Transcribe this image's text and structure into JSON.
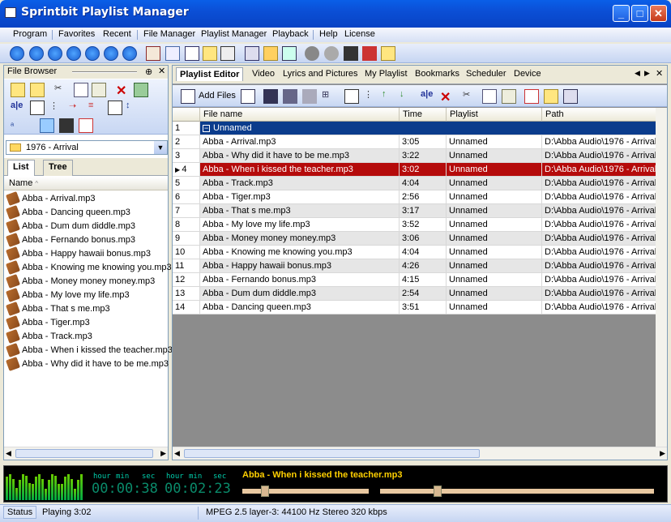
{
  "window": {
    "title": "Sprintbit Playlist Manager"
  },
  "menu": [
    "Program",
    "Favorites",
    "Recent",
    "File Manager",
    "Playlist Manager",
    "Playback",
    "Help",
    "License"
  ],
  "file_browser": {
    "title": "File Browser",
    "folder": "1976 - Arrival",
    "tabs": [
      "List",
      "Tree"
    ],
    "column": "Name",
    "files": [
      "Abba - Arrival.mp3",
      "Abba - Dancing queen.mp3",
      "Abba - Dum dum diddle.mp3",
      "Abba - Fernando bonus.mp3",
      "Abba - Happy hawaii bonus.mp3",
      "Abba - Knowing me knowing you.mp3",
      "Abba - Money money money.mp3",
      "Abba - My love my life.mp3",
      "Abba - That s me.mp3",
      "Abba - Tiger.mp3",
      "Abba - Track.mp3",
      "Abba - When i kissed the teacher.mp3",
      "Abba - Why did it have to be me.mp3"
    ]
  },
  "editor": {
    "tabs": [
      "Playlist Editor",
      "Video",
      "Lyrics and Pictures",
      "My Playlist",
      "Bookmarks",
      "Scheduler",
      "Device"
    ],
    "add_files_label": "Add Files",
    "columns": [
      "File name",
      "Time",
      "Playlist",
      "Path"
    ],
    "group_label": "Unnamed",
    "rows": [
      {
        "n": "2",
        "name": "Abba - Arrival.mp3",
        "time": "3:05",
        "playlist": "Unnamed",
        "path": "D:\\Abba Audio\\1976 - Arrival..."
      },
      {
        "n": "3",
        "name": "Abba - Why did it have to be me.mp3",
        "time": "3:22",
        "playlist": "Unnamed",
        "path": "D:\\Abba Audio\\1976 - Arrival..."
      },
      {
        "n": "4",
        "name": "Abba - When i kissed the teacher.mp3",
        "time": "3:02",
        "playlist": "Unnamed",
        "path": "D:\\Abba Audio\\1976 - Arrival..."
      },
      {
        "n": "5",
        "name": "Abba - Track.mp3",
        "time": "4:04",
        "playlist": "Unnamed",
        "path": "D:\\Abba Audio\\1976 - Arrival..."
      },
      {
        "n": "6",
        "name": "Abba - Tiger.mp3",
        "time": "2:56",
        "playlist": "Unnamed",
        "path": "D:\\Abba Audio\\1976 - Arrival..."
      },
      {
        "n": "7",
        "name": "Abba - That s me.mp3",
        "time": "3:17",
        "playlist": "Unnamed",
        "path": "D:\\Abba Audio\\1976 - Arrival..."
      },
      {
        "n": "8",
        "name": "Abba - My love my life.mp3",
        "time": "3:52",
        "playlist": "Unnamed",
        "path": "D:\\Abba Audio\\1976 - Arrival..."
      },
      {
        "n": "9",
        "name": "Abba - Money money money.mp3",
        "time": "3:06",
        "playlist": "Unnamed",
        "path": "D:\\Abba Audio\\1976 - Arrival..."
      },
      {
        "n": "10",
        "name": "Abba - Knowing me knowing you.mp3",
        "time": "4:04",
        "playlist": "Unnamed",
        "path": "D:\\Abba Audio\\1976 - Arrival..."
      },
      {
        "n": "11",
        "name": "Abba - Happy hawaii bonus.mp3",
        "time": "4:26",
        "playlist": "Unnamed",
        "path": "D:\\Abba Audio\\1976 - Arrival..."
      },
      {
        "n": "12",
        "name": "Abba - Fernando bonus.mp3",
        "time": "4:15",
        "playlist": "Unnamed",
        "path": "D:\\Abba Audio\\1976 - Arrival..."
      },
      {
        "n": "13",
        "name": "Abba - Dum dum diddle.mp3",
        "time": "2:54",
        "playlist": "Unnamed",
        "path": "D:\\Abba Audio\\1976 - Arrival..."
      },
      {
        "n": "14",
        "name": "Abba - Dancing queen.mp3",
        "time": "3:51",
        "playlist": "Unnamed",
        "path": "D:\\Abba Audio\\1976 - Arrival..."
      }
    ]
  },
  "player": {
    "labels": [
      "hour",
      "min",
      "sec",
      "hour",
      "min",
      "sec"
    ],
    "elapsed": "00:00:38",
    "remaining": "00:02:23",
    "track": "Abba - When i kissed the teacher.mp3",
    "position": 0.16,
    "volume": 0.2
  },
  "status": {
    "label": "Status",
    "playing": "Playing 3:02",
    "format": "MPEG 2.5 layer-3: 44100 Hz  Stereo 320 kbps"
  }
}
